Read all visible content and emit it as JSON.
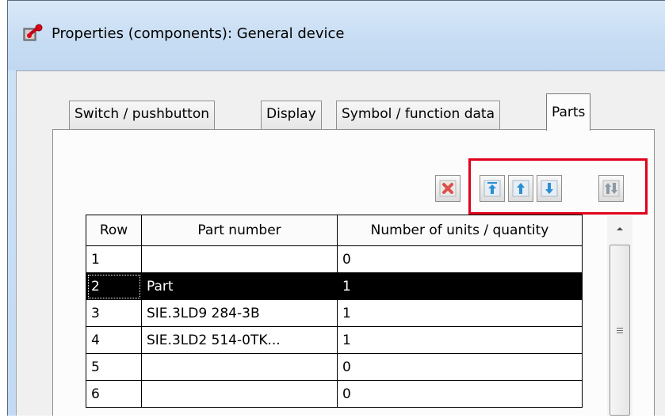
{
  "window": {
    "title": "Properties (components): General device"
  },
  "tabs": [
    {
      "label": "Switch / pushbutton",
      "active": false
    },
    {
      "label": "Display",
      "active": false
    },
    {
      "label": "Symbol / function data",
      "active": false
    },
    {
      "label": "Parts",
      "active": true
    }
  ],
  "toolbar": {
    "buttons": [
      {
        "icon": "delete-icon"
      },
      {
        "icon": "move-to-top-icon"
      },
      {
        "icon": "move-up-icon"
      },
      {
        "icon": "move-down-icon"
      },
      {
        "icon": "sort-icon"
      }
    ],
    "highlight_color": "#e0001b"
  },
  "table": {
    "columns": [
      "Row",
      "Part number",
      "Number of units / quantity"
    ],
    "rows": [
      {
        "row": "1",
        "part_number": "",
        "quantity": "0"
      },
      {
        "row": "2",
        "part_number": "Part",
        "quantity": "1",
        "selected": true
      },
      {
        "row": "3",
        "part_number": "SIE.3LD9 284-3B",
        "quantity": "1"
      },
      {
        "row": "4",
        "part_number": "SIE.3LD2 514-0TK...",
        "quantity": "1"
      },
      {
        "row": "5",
        "part_number": "",
        "quantity": "0"
      },
      {
        "row": "6",
        "part_number": "",
        "quantity": "0"
      }
    ]
  }
}
